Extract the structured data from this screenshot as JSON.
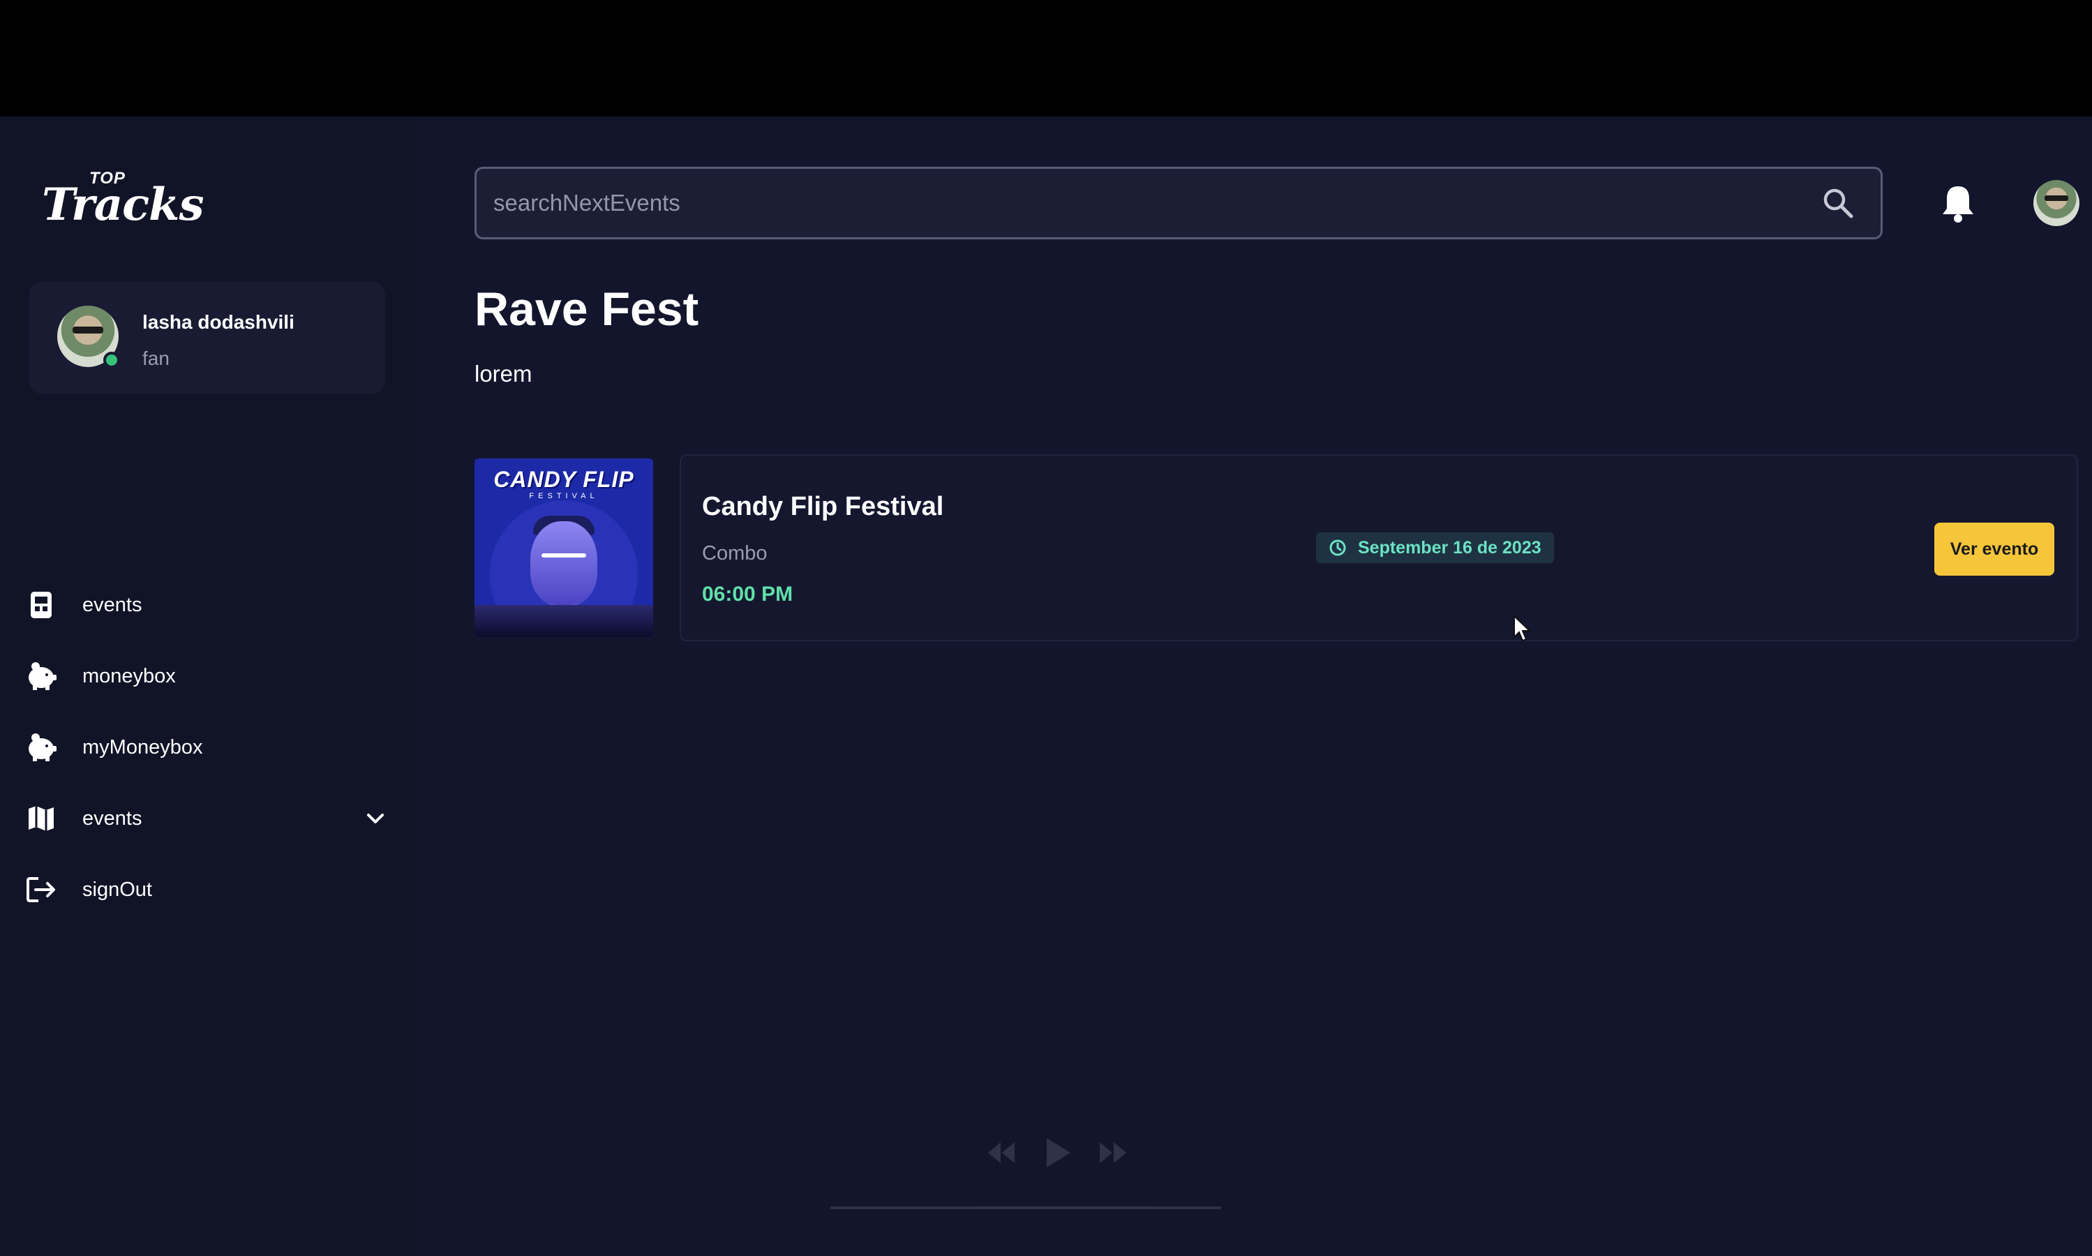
{
  "app": {
    "logo_top": "TOP",
    "logo_main": "Tracks"
  },
  "user": {
    "name": "lasha dodashvili",
    "role": "fan",
    "status_color": "#35c27a"
  },
  "sidebar": {
    "items": [
      {
        "label": "events",
        "icon": "calendar-icon"
      },
      {
        "label": "moneybox",
        "icon": "piggy-bank-icon"
      },
      {
        "label": "myMoneybox",
        "icon": "piggy-bank-icon"
      },
      {
        "label": "events",
        "icon": "map-icon",
        "has_chevron": true
      },
      {
        "label": "signOut",
        "icon": "sign-out-icon"
      }
    ]
  },
  "search": {
    "placeholder": "searchNextEvents",
    "icon": "search-icon"
  },
  "header": {
    "notification_icon": "bell-icon"
  },
  "page": {
    "title": "Rave Fest",
    "subtitle": "lorem"
  },
  "event": {
    "thumb_title": "CANDY FLIP",
    "thumb_subtitle": "FESTIVAL",
    "name": "Candy Flip Festival",
    "type": "Combo",
    "time": "06:00 PM",
    "date": "September 16 de 2023",
    "button_label": "Ver evento"
  },
  "colors": {
    "accent_button": "#f5c53a",
    "time_green": "#5fe0a8",
    "date_teal": "#6ce2c3",
    "background": "#13152d",
    "sidebar": "#111327"
  }
}
